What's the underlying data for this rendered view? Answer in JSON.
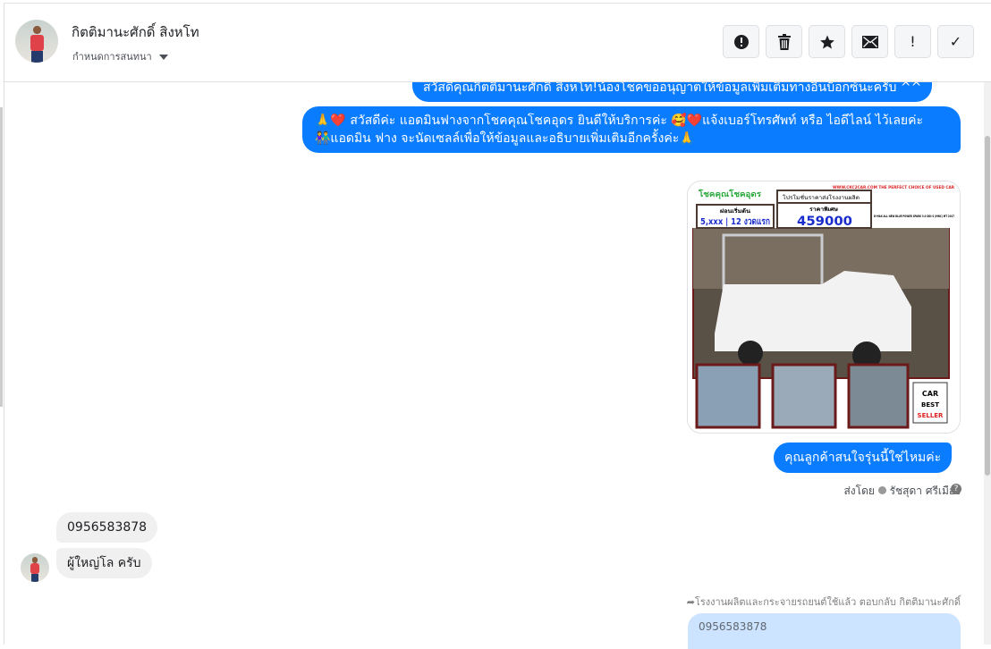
{
  "header": {
    "contact_name": "กิตติมานะศักดิ์ สิงหโท",
    "subtitle": "กำหนดการสนทนา",
    "actions": [
      {
        "name": "mark-spam-button",
        "icon": "exclamation-circle-icon"
      },
      {
        "name": "delete-button",
        "icon": "trash-icon"
      },
      {
        "name": "star-button",
        "icon": "star-icon"
      },
      {
        "name": "mark-unread-button",
        "icon": "envelope-icon"
      },
      {
        "name": "follow-up-button",
        "icon": "exclamation-icon",
        "glyph": "!"
      },
      {
        "name": "mark-done-button",
        "icon": "checkmark-icon",
        "glyph": "✓"
      }
    ]
  },
  "messages": {
    "m1": "สวัสดีคุณกิตติมานะศักดิ์ สิงหโท!น้องโชคขออนุญาตให้ข้อมูลเพิ่มเติมทางอินบ็อกซ์นะครับ ^^",
    "m2_line1": "🙏❤️ สวัสดีค่ะ แอดมินฟางจากโชคคุณโชคอุดร ยินดีให้บริการค่ะ 🥰❤️แจ้งเบอร์โทรศัพท์ หรือ ไอดีไลน์  ไว้เลยค่ะ",
    "m2_line2": "👫แอดมิน ฟาง จะนัดเซลล์เพื่อให้ข้อมูลและอธิบายเพิ่มเติมอีกครั้งค่ะ🙏",
    "m3": "คุณลูกค้าสนใจรุ่นนี้ใช่ไหมค่ะ",
    "sent_by_label": "ส่งโดย",
    "sent_by_name": "รัชสุดา ศรีเมือง",
    "in1": "0956583878",
    "in2": "ผู้ใหญ่โล ครับ",
    "reply_note": "โรงงานผลิตและกระจายรถยนต์ใช้แล้ว ตอบกลับ กิตติมานะศักดิ์",
    "reply_quote": "0956583878"
  },
  "car_ad": {
    "brand": "โชคคุณโชคอุดร",
    "site": "WWW.CKC2CAR.COM THE PERFECT CHOICE OF USED CAR",
    "promo": "โปรโมชั่นราคาส่งโรงงานผลิต",
    "down_label": "ผ่อนเริ่มต้น",
    "down_value": "5,xxx | 12 งวดแรก",
    "price_label": "ราคาพิเศษ",
    "price": "459000",
    "model": "D-MAX ALL NEW BLUE POWER SPARK 3.0 DDI S (MNC) MT 2017",
    "badge": "CAR BEST SELLER"
  }
}
